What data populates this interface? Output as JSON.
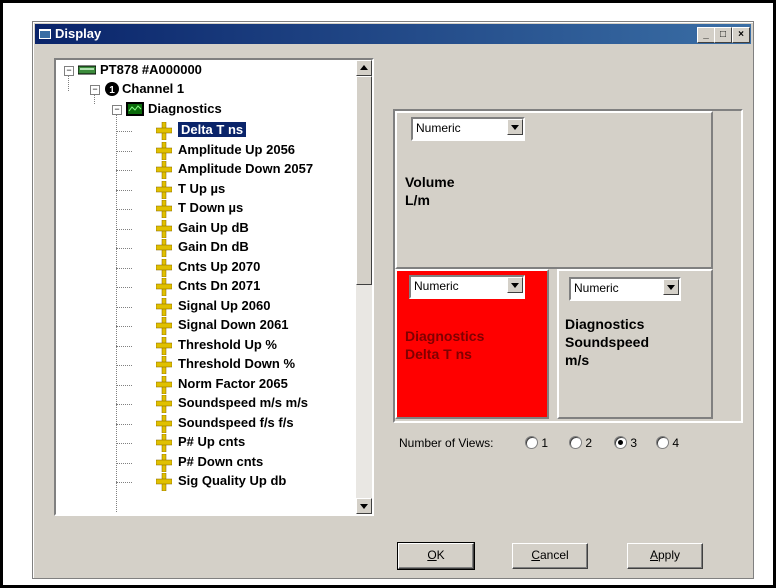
{
  "window": {
    "title": "Display",
    "controls": {
      "minimize": "_",
      "maximize": "□",
      "close": "×"
    }
  },
  "tree": {
    "root": "PT878 #A000000",
    "channel": "Channel 1",
    "group": "Diagnostics",
    "items": [
      "Delta T ns",
      "Amplitude Up 2056",
      "Amplitude Down 2057",
      "T Up µs",
      "T Down µs",
      "Gain Up dB",
      "Gain Dn dB",
      "Cnts Up 2070",
      "Cnts Dn 2071",
      "Signal Up 2060",
      "Signal Down 2061",
      "Threshold Up %",
      "Threshold Down %",
      "Norm Factor 2065",
      "Soundspeed m/s m/s",
      "Soundspeed f/s f/s",
      "P# Up cnts",
      "P# Down cnts",
      "Sig Quality Up db"
    ],
    "selected_index": 0
  },
  "panes": {
    "top": {
      "combo": "Numeric",
      "line1": "Volume",
      "line2": "L/m"
    },
    "bottom_left": {
      "combo": "Numeric",
      "line1": "Diagnostics",
      "line2": "Delta T ns",
      "bg": "#ff0000",
      "fg": "#800000"
    },
    "bottom_right": {
      "combo": "Numeric",
      "line1": "Diagnostics",
      "line2": "Soundspeed",
      "line3": "m/s"
    }
  },
  "views": {
    "label": "Number of Views:",
    "options": [
      "1",
      "2",
      "3",
      "4"
    ],
    "selected": "3"
  },
  "buttons": {
    "ok": "OK",
    "cancel": "Cancel",
    "apply": "Apply"
  },
  "colors": {
    "titlebar": "#0a246a",
    "selection": "#0a246a",
    "face": "#d4d0c8"
  }
}
